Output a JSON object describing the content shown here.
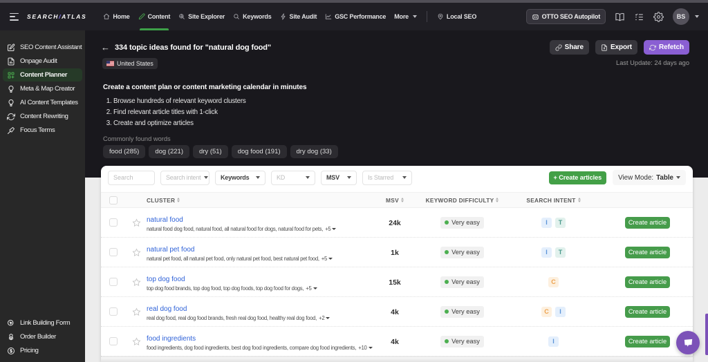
{
  "topbar": {
    "logo_left": "SEARCH",
    "logo_slash": "/",
    "logo_right": "ATLAS",
    "nav": [
      {
        "label": "Home",
        "icon": "home-icon",
        "active": false
      },
      {
        "label": "Content",
        "icon": "pencil-icon",
        "active": true
      },
      {
        "label": "Site Explorer",
        "icon": "search-globe-icon",
        "active": false
      },
      {
        "label": "Keywords",
        "icon": "search-icon",
        "active": false
      },
      {
        "label": "Site Audit",
        "icon": "audit-icon",
        "active": false
      },
      {
        "label": "GSC Performance",
        "icon": "chart-icon",
        "active": false
      },
      {
        "label": "More",
        "icon": "",
        "active": false,
        "caret": true
      },
      {
        "label": "Local SEO",
        "icon": "pin-icon",
        "active": false,
        "divided": true
      }
    ],
    "otto_button": "OTTO SEO Autopilot",
    "avatar": "BS"
  },
  "sidebar": {
    "items": [
      {
        "label": "SEO Content Assistant",
        "icon": "edit-icon",
        "active": false
      },
      {
        "label": "Onpage Audit",
        "icon": "document-icon",
        "active": false
      },
      {
        "label": "Content Planner",
        "icon": "grid-plus-icon",
        "active": true
      },
      {
        "label": "Meta & Map Creator",
        "icon": "bulb-icon",
        "active": false
      },
      {
        "label": "AI Content Templates",
        "icon": "bulb-icon",
        "active": false
      },
      {
        "label": "Content Rewriting",
        "icon": "refresh-icon",
        "active": false
      },
      {
        "label": "Focus Terms",
        "icon": "pen-icon",
        "active": false
      }
    ],
    "bottom_items": [
      {
        "label": "Link Building Form",
        "icon": "cursor-icon"
      },
      {
        "label": "Order Builder",
        "icon": "cubes-icon"
      },
      {
        "label": "Pricing",
        "icon": "dollar-icon"
      }
    ]
  },
  "header": {
    "back": "←",
    "title": "334 topic ideas found for \"natural dog food\"",
    "country": "United States",
    "share_label": "Share",
    "export_label": "Export",
    "refetch_label": "Refetch",
    "last_update": "Last Update: 24 days ago"
  },
  "intro": {
    "heading": "Create a content plan or content marketing calendar in minutes",
    "steps": [
      "Browse hundreds of relevant keyword clusters",
      "Find relevant article titles with 1-click",
      "Create and optimize articles"
    ]
  },
  "common_words": {
    "label": "Commonly found words",
    "chips": [
      "food (285)",
      "dog (221)",
      "dry (51)",
      "dog food (191)",
      "dry dog (33)"
    ]
  },
  "toolbar": {
    "search_placeholder": "Search",
    "filters": [
      {
        "label": "Search intent",
        "filled": false
      },
      {
        "label": "Keywords",
        "filled": true
      },
      {
        "label": "KD",
        "filled": false
      },
      {
        "label": "MSV",
        "filled": true
      },
      {
        "label": "Is Starred",
        "filled": false
      }
    ],
    "create_articles_label": "+ Create articles",
    "view_mode_label": "View Mode:",
    "view_mode_value": "Table"
  },
  "table": {
    "columns": [
      "CLUSTER",
      "MSV",
      "KEYWORD DIFFICULTY",
      "SEARCH INTENT"
    ],
    "rows": [
      {
        "cluster": "natural food",
        "keywords": "natural food dog food, natural food, all natural food for dogs, natural food for pets,",
        "more": "+5",
        "msv": "24k",
        "difficulty": "Very easy",
        "intents": [
          "I",
          "T"
        ]
      },
      {
        "cluster": "natural pet food",
        "keywords": "natural pet food, all natural pet food, only natural pet food, best natural pet food,",
        "more": "+5",
        "msv": "1k",
        "difficulty": "Very easy",
        "intents": [
          "I",
          "T"
        ]
      },
      {
        "cluster": "top dog food",
        "keywords": "top dog food brands, top dog food, top dog foods, top dog food for dogs,",
        "more": "+5",
        "msv": "15k",
        "difficulty": "Very easy",
        "intents": [
          "C"
        ]
      },
      {
        "cluster": "real dog food",
        "keywords": "real dog food, real dog food brands, fresh real dog food, healthy real dog food,",
        "more": "+2",
        "msv": "4k",
        "difficulty": "Very easy",
        "intents": [
          "C",
          "I"
        ]
      },
      {
        "cluster": "food ingredients",
        "keywords": "food ingredients, dog food ingredients, best dog food ingredients, compare dog food ingredients,",
        "more": "+10",
        "msv": "4k",
        "difficulty": "Very easy",
        "intents": [
          "I"
        ]
      }
    ],
    "row_action_label": "Create article"
  },
  "colors": {
    "accent_green": "#43a047",
    "accent_purple": "#8a5fd3",
    "link_blue": "#2f62d8",
    "intent": {
      "I": {
        "bg": "#e4effc",
        "fg": "#5b94d8"
      },
      "T": {
        "bg": "#e2f1ed",
        "fg": "#4a9a8b"
      },
      "C": {
        "bg": "#fdf0df",
        "fg": "#eda14c"
      }
    }
  }
}
